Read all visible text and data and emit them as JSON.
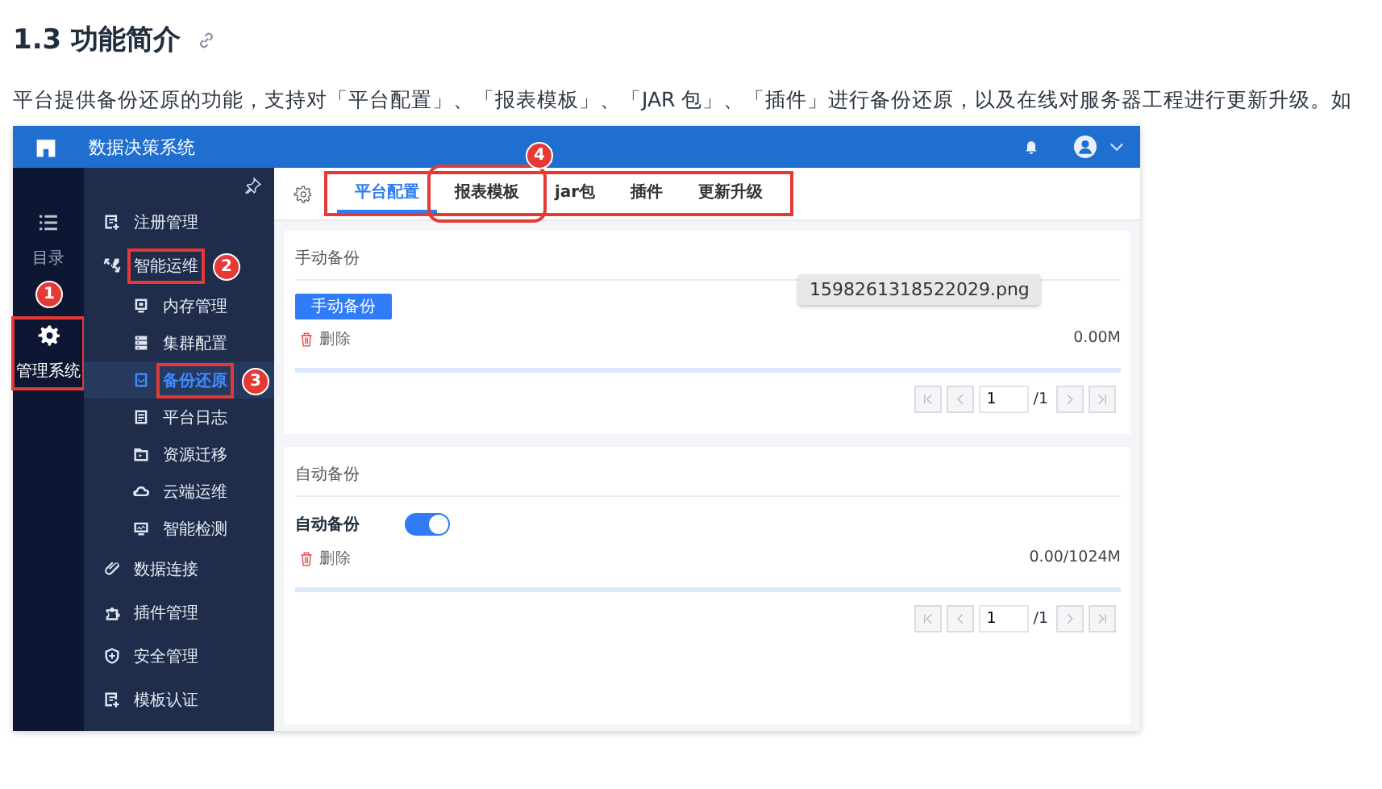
{
  "heading": {
    "title": "1.3 功能简介"
  },
  "intro": "平台提供备份还原的功能，支持对「平台配置」、「报表模板」、「JAR 包」、「插件」进行备份还原，以及在线对服务器工程进行更新升级。如",
  "screenshot": {
    "app_title": "数据决策系统",
    "rail": [
      {
        "label": "目录",
        "selected": false,
        "highlighted": false
      },
      {
        "label": "管理系统",
        "selected": true,
        "highlighted": true,
        "marker": "1"
      }
    ],
    "nav": [
      {
        "label": "注册管理",
        "selected": false,
        "highlighted": false
      },
      {
        "label": "智能运维",
        "selected": false,
        "highlighted": true,
        "marker": "2",
        "children": [
          {
            "label": "内存管理",
            "selected": false,
            "highlighted": false
          },
          {
            "label": "集群配置",
            "selected": false,
            "highlighted": false
          },
          {
            "label": "备份还原",
            "selected": true,
            "highlighted": true,
            "marker": "3"
          },
          {
            "label": "平台日志",
            "selected": false,
            "highlighted": false
          },
          {
            "label": "资源迁移",
            "selected": false,
            "highlighted": false
          },
          {
            "label": "云端运维",
            "selected": false,
            "highlighted": false
          },
          {
            "label": "智能检测",
            "selected": false,
            "highlighted": false
          }
        ]
      },
      {
        "label": "数据连接",
        "selected": false,
        "highlighted": false
      },
      {
        "label": "插件管理",
        "selected": false,
        "highlighted": false
      },
      {
        "label": "安全管理",
        "selected": false,
        "highlighted": false
      },
      {
        "label": "模板认证",
        "selected": false,
        "highlighted": false
      }
    ],
    "tabs_highlighted": true,
    "tabs": [
      {
        "label": "平台配置",
        "selected": true,
        "highlighted": false
      },
      {
        "label": "报表模板",
        "selected": false,
        "highlighted": true,
        "marker": "4"
      },
      {
        "label": "jar包",
        "selected": false,
        "highlighted": false
      },
      {
        "label": "插件",
        "selected": false,
        "highlighted": false
      },
      {
        "label": "更新升级",
        "selected": false,
        "highlighted": false
      }
    ],
    "manual": {
      "title": "手动备份",
      "button": "手动备份",
      "delete": "删除",
      "size": "0.00M",
      "page": "1",
      "pages": "/1"
    },
    "auto": {
      "title": "自动备份",
      "toggle_label": "自动备份",
      "on": true,
      "delete": "删除",
      "size": "0.00/1024M",
      "page": "1",
      "pages": "/1"
    },
    "tooltip": "1598261318522029.png"
  }
}
